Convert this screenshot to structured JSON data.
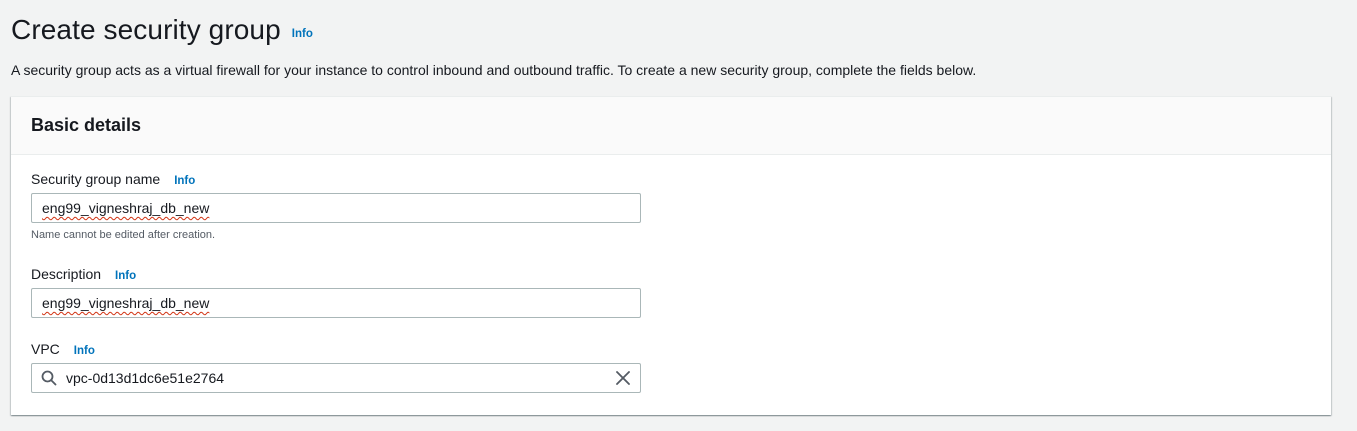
{
  "page": {
    "title": "Create security group",
    "info_label": "Info",
    "description": "A security group acts as a virtual firewall for your instance to control inbound and outbound traffic. To create a new security group, complete the fields below."
  },
  "basic_details": {
    "title": "Basic details",
    "name_field": {
      "label": "Security group name",
      "info_label": "Info",
      "value": "eng99_vigneshraj_db_new",
      "constraint": "Name cannot be edited after creation."
    },
    "description_field": {
      "label": "Description",
      "info_label": "Info",
      "value": "eng99_vigneshraj_db_new"
    },
    "vpc_field": {
      "label": "VPC",
      "info_label": "Info",
      "value": "vpc-0d13d1dc6e51e2764",
      "search_icon": "search-icon",
      "clear_icon": "close-icon"
    }
  },
  "colors": {
    "link": "#0073bb",
    "background": "#f2f3f3",
    "text": "#16191f",
    "border": "#aab7b8"
  }
}
